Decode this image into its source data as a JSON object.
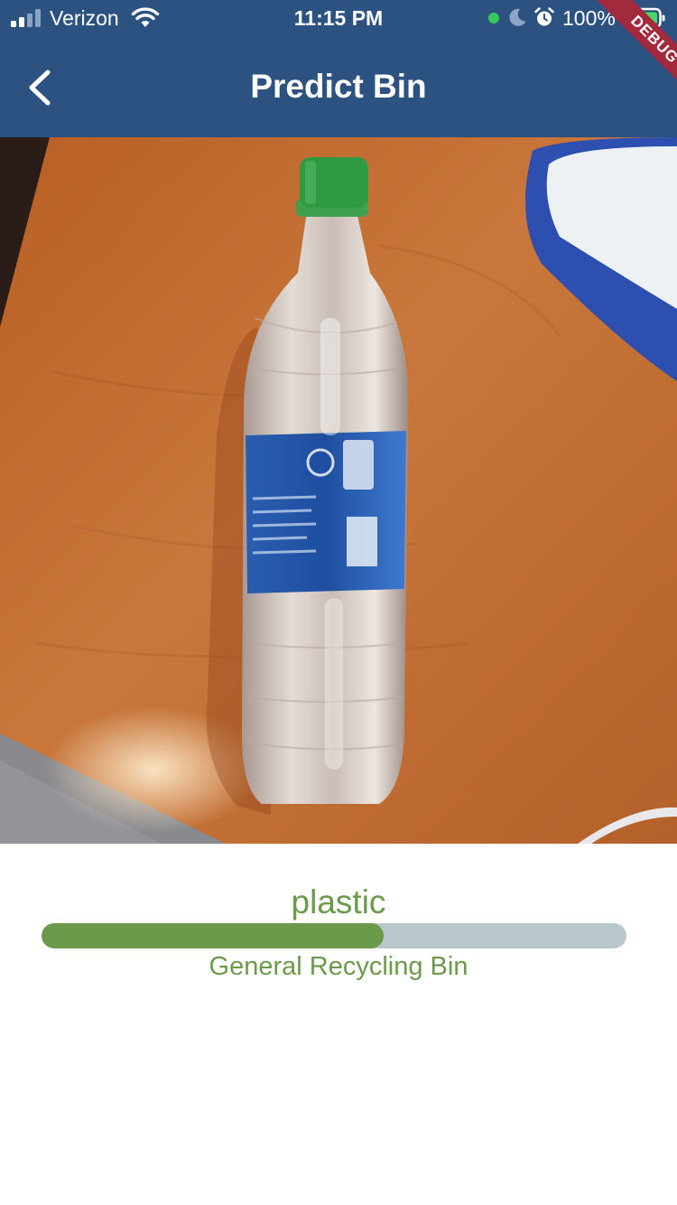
{
  "status_bar": {
    "carrier": "Verizon",
    "time": "11:15 PM",
    "battery_percent": "100%",
    "icons": [
      "cellular-signal-icon",
      "wifi-icon",
      "camera-in-use-dot",
      "moon-icon",
      "alarm-icon",
      "battery-charging-icon"
    ],
    "indicator_color": "#34c759"
  },
  "app_bar": {
    "title": "Predict Bin",
    "back_icon": "chevron-left-icon",
    "debug_banner": "DEBUG",
    "background_color": "#2c5282"
  },
  "photo": {
    "alt": "Photo of a plastic water bottle with a green cap lying on a wooden desk"
  },
  "prediction": {
    "label": "plastic",
    "confidence": 0.585,
    "bin": "General Recycling Bin",
    "accent_color": "#6a9a4a",
    "track_color": "#b8c8cc"
  }
}
